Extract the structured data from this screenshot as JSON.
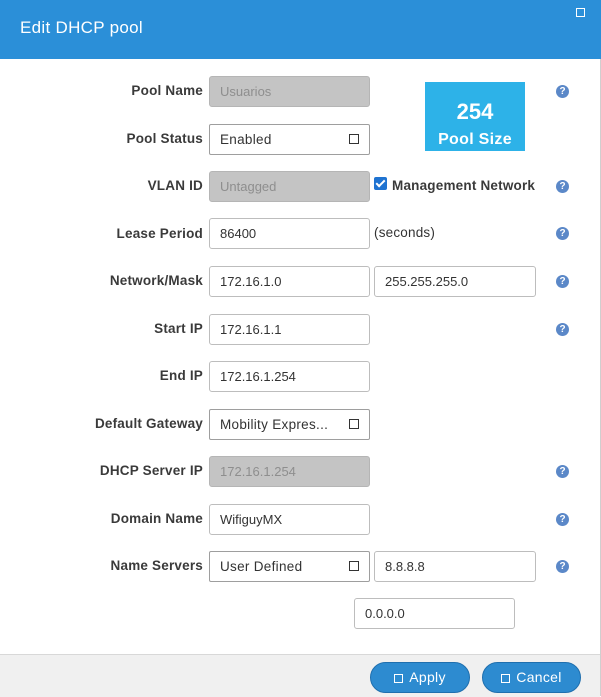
{
  "dialog": {
    "title": "Edit DHCP pool"
  },
  "pool_name": {
    "label": "Pool Name",
    "value": "Usuarios"
  },
  "pool_size": {
    "value": "254",
    "label": "Pool Size"
  },
  "pool_status": {
    "label": "Pool Status",
    "value": "Enabled"
  },
  "vlan": {
    "label": "VLAN ID",
    "value": "Untagged",
    "mgmt_label": "Management Network",
    "mgmt_checked": true
  },
  "lease": {
    "label": "Lease Period",
    "value": "86400",
    "unit": "(seconds)"
  },
  "network": {
    "label": "Network/Mask",
    "address": "172.16.1.0",
    "mask": "255.255.255.0"
  },
  "start_ip": {
    "label": "Start IP",
    "value": "172.16.1.1"
  },
  "end_ip": {
    "label": "End IP",
    "value": "172.16.1.254"
  },
  "gateway": {
    "label": "Default Gateway",
    "value": "Mobility Expres..."
  },
  "dhcp_server": {
    "label": "DHCP Server IP",
    "value": "172.16.1.254"
  },
  "domain": {
    "label": "Domain Name",
    "value": "WifiguyMX"
  },
  "name_servers": {
    "label": "Name Servers",
    "mode": "User Defined",
    "primary": "8.8.8.8",
    "secondary": "0.0.0.0"
  },
  "help_glyph": "?",
  "footer": {
    "apply_label": "Apply",
    "cancel_label": "Cancel"
  },
  "colors": {
    "header": "#2b8fd8",
    "pool_size_bg": "#2db2e8",
    "button": "#2d8bd0",
    "help": "#5b88c8"
  }
}
